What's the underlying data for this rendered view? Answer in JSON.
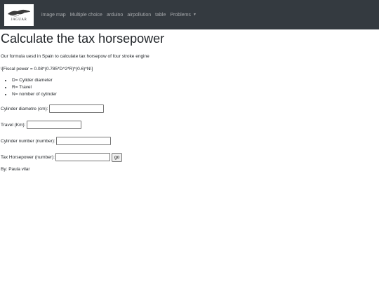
{
  "navbar": {
    "brand_text": "JAGUAR",
    "items": [
      {
        "label": "image map"
      },
      {
        "label": "Multiple choice"
      },
      {
        "label": "arduino"
      },
      {
        "label": "airpollution"
      },
      {
        "label": "table"
      },
      {
        "label": "Problems"
      }
    ],
    "colors": {
      "background": "#343a40",
      "link": "rgba(255,255,255,0.55)"
    }
  },
  "page": {
    "title": "Calculate the tax horsepower",
    "intro": "Our formula uesd in Spain to calculate tax horsepow of four stroke engine",
    "formula": "\\[Fiscal power = 0.08*(0.785*D^2*R)*(0.6)*N\\]",
    "legend": [
      "D= Cylider diameter",
      "R= Travel",
      "N= nomber of cylinder"
    ]
  },
  "form": {
    "diameter_label": "Cylinder diametre (cm):",
    "diameter_value": "",
    "travel_label": "Travel (Km):",
    "travel_value": "",
    "cylinders_label": "Cylinder number (number):",
    "cylinders_value": "",
    "result_label": "Tax Horsepower (number):",
    "result_value": "",
    "go_label": "go"
  },
  "footer": {
    "author": "By: Paula vilar"
  }
}
